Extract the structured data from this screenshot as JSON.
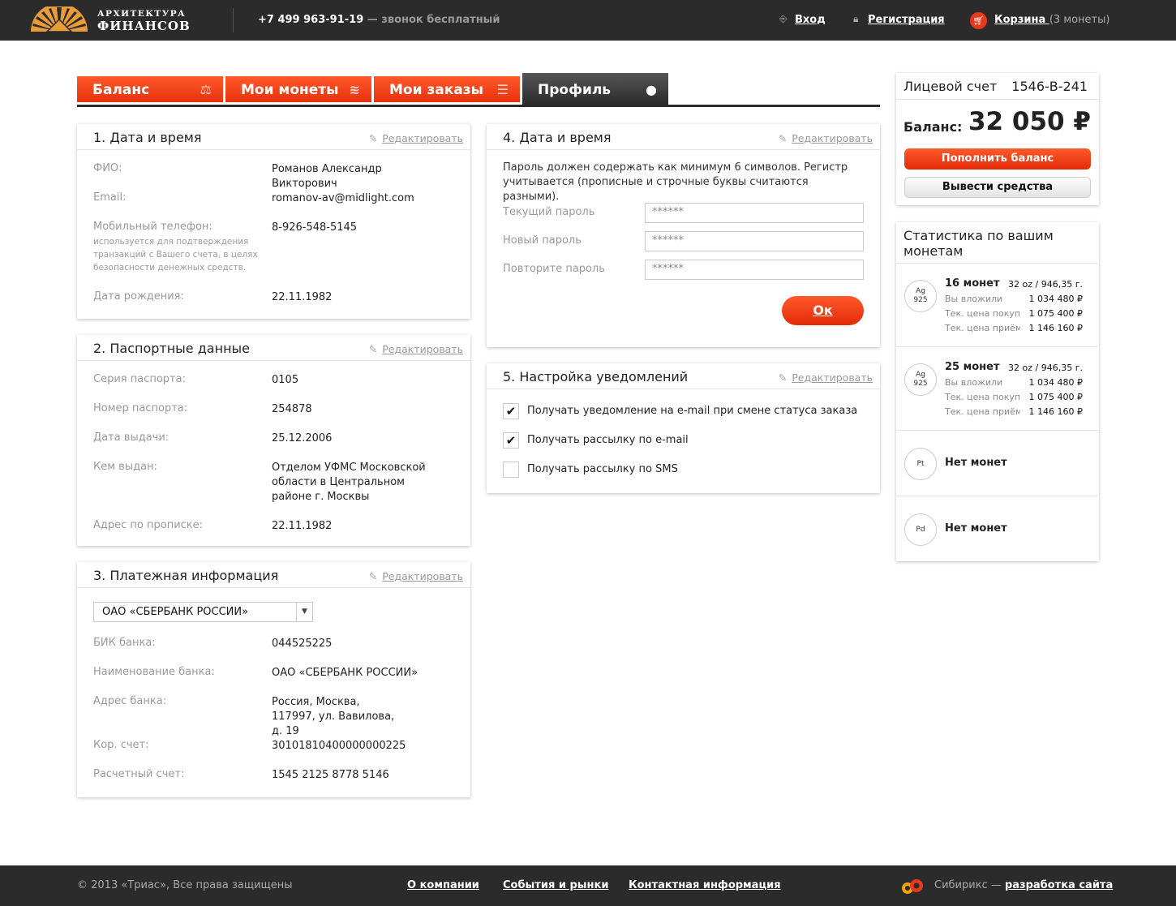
{
  "header": {
    "logo_line1": "АРХИТЕКТУРА",
    "logo_line2": "ФИНАНСОВ",
    "phone": "+7 499 963-91-19",
    "phone_note": "— звонок бесплатный",
    "login_label": "Вход",
    "register_label": "Регистрация",
    "cart_label": "Корзина",
    "cart_count": "(3 монеты)"
  },
  "tabs": [
    {
      "label": "Баланс",
      "icon": "scales-icon",
      "glyph": "⚖"
    },
    {
      "label": "Мои монеты",
      "icon": "coins-icon",
      "glyph": "≋"
    },
    {
      "label": "Мои заказы",
      "icon": "list-icon",
      "glyph": "☰"
    },
    {
      "label": "Профиль",
      "icon": "user-icon",
      "glyph": "●",
      "active": true
    }
  ],
  "edit_label": "Редактировать",
  "personal": {
    "title": "1. Дата и время",
    "fio_label": "ФИО:",
    "fio_value": "Романов Александр Викторович",
    "email_label": "Email:",
    "email_value": "romanov-av@midlight.com",
    "phone_label": "Мобильный телефон:",
    "phone_note": "используется для подтверждения транзакций с Вашего счета, в целях безопасности денежных средств.",
    "phone_value": "8-926-548-5145",
    "birth_label": "Дата рождения:",
    "birth_value": "22.11.1982"
  },
  "passport": {
    "title": "2. Паспортные данные",
    "series_label": "Серия паспорта:",
    "series_value": "0105",
    "number_label": "Номер паспорта:",
    "number_value": "254878",
    "issue_date_label": "Дата выдачи:",
    "issue_date_value": "25.12.2006",
    "issued_by_label": "Кем выдан:",
    "issued_by_value": "Отделом УФМС Московской области в Центральном районе г. Москвы",
    "address_label": "Адрес по прописке:",
    "address_value": "22.11.1982"
  },
  "payment": {
    "title": "3. Платежная информация",
    "bank_select": "ОАО «СБЕРБАНК РОССИИ»",
    "bik_label": "БИК банка:",
    "bik_value": "044525225",
    "bank_name_label": "Наименование банка:",
    "bank_name_value": "ОАО «СБЕРБАНК РОССИИ»",
    "bank_address_label": "Адрес банка:",
    "bank_address_value": "Россия, Москва, 117997, ул. Вавилова, д. 19",
    "corr_label": "Кор. счет:",
    "corr_value": "30101810400000000225",
    "account_label": "Расчетный счет:",
    "account_value": "1545 2125 8778 5146"
  },
  "password": {
    "title": "4. Дата и время",
    "note": "Пароль должен содержать как минимум 6 символов. Регистр учитывается (прописные и строчные буквы считаются разными).",
    "current_label": "Текущий пароль",
    "new_label": "Новый пароль",
    "repeat_label": "Повторите пароль",
    "mask": "******",
    "ok_label": "Ок"
  },
  "notifications": {
    "title": "5. Настройка уведомлений",
    "items": [
      {
        "label": "Получать уведомление на e-mail при смене статуса заказа",
        "mark": "✔"
      },
      {
        "label": "Получать рассылку по e-mail",
        "mark": "✔"
      },
      {
        "label": "Получать рассылку по SMS",
        "mark": ""
      }
    ]
  },
  "account": {
    "title": "Лицевой счет",
    "number": "1546-B-241",
    "balance_label": "Баланс:",
    "balance_value": "32 050 ₽",
    "topup_label": "Пополнить баланс",
    "withdraw_label": "Вывести средства"
  },
  "stats": {
    "title": "Статистика по вашим монетам",
    "invested_label": "Вы вложили",
    "buy_label": "Тек. цена покупки",
    "sell_label": "Тек. цена приёма",
    "groups": [
      {
        "metal": "Ag",
        "purity": "925",
        "title": "16 монет",
        "oz": "32 oz / 946,35 г.",
        "invested": "1 034 480 ₽",
        "buy": "1 075 400 ₽",
        "sell": "1 146 160 ₽"
      },
      {
        "metal": "Ag",
        "purity": "925",
        "title": "25 монет",
        "oz": "32 oz / 946,35 г.",
        "invested": "1 034 480 ₽",
        "buy": "1 075 400 ₽",
        "sell": "1 146 160 ₽"
      },
      {
        "metal": "Pt",
        "title": "Нет монет"
      },
      {
        "metal": "Pd",
        "title": "Нет монет"
      }
    ]
  },
  "footer": {
    "copyright": "© 2013 «Триас», Все права защищены",
    "about": "О компании",
    "events": "События и рынки",
    "contacts": "Контактная информация",
    "bitrix_text": "Сибирикс —",
    "bitrix_link": "разработка сайта"
  },
  "colors": {
    "accent": "#e8391a",
    "dark": "#2b2b2b"
  }
}
